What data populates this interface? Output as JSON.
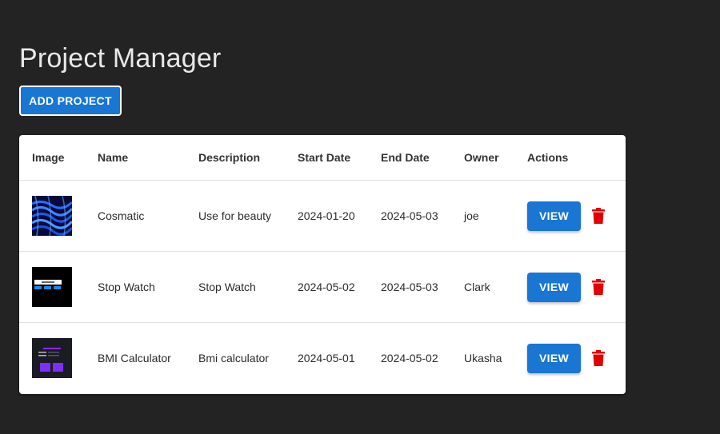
{
  "header": {
    "title": "Project Manager",
    "add_button_label": "ADD PROJECT"
  },
  "table": {
    "columns": [
      "Image",
      "Name",
      "Description",
      "Start Date",
      "End Date",
      "Owner",
      "Actions"
    ],
    "rows": [
      {
        "image": "blue-waves-thumbnail",
        "name": "Cosmatic",
        "description": "Use for beauty",
        "start_date": "2024-01-20",
        "end_date": "2024-05-03",
        "owner": "joe",
        "view_label": "VIEW"
      },
      {
        "image": "stopwatch-app-thumbnail",
        "name": "Stop Watch",
        "description": "Stop Watch",
        "start_date": "2024-05-02",
        "end_date": "2024-05-03",
        "owner": "Clark",
        "view_label": "VIEW"
      },
      {
        "image": "bmi-app-thumbnail",
        "name": "BMI Calculator",
        "description": "Bmi calculator",
        "start_date": "2024-05-01",
        "end_date": "2024-05-02",
        "owner": "Ukasha",
        "view_label": "VIEW"
      }
    ]
  },
  "colors": {
    "background": "#232323",
    "primary": "#1976d2",
    "delete": "#e00000",
    "card": "#ffffff"
  },
  "icons": {
    "delete": "trash-icon"
  }
}
